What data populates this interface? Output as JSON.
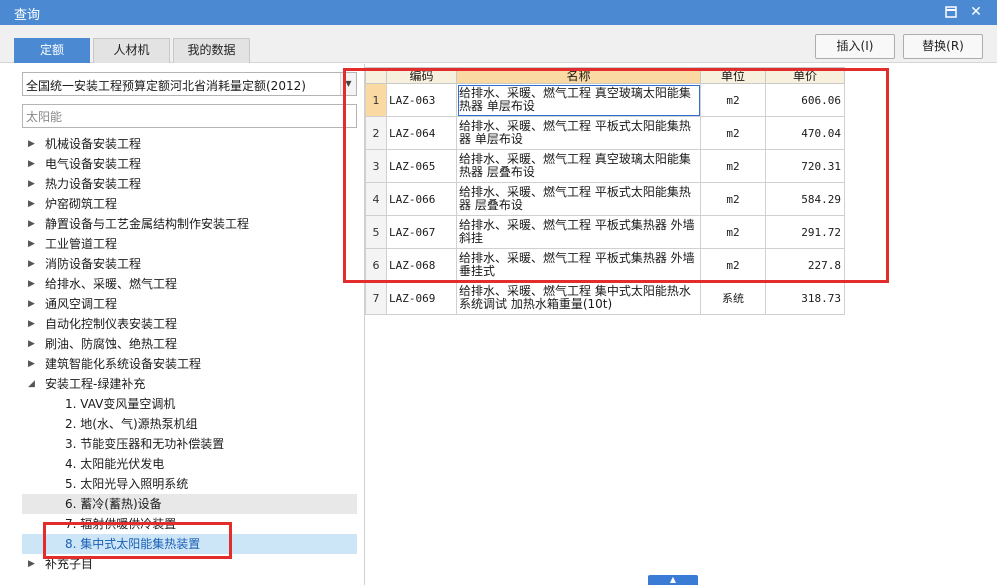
{
  "window": {
    "title": "查询"
  },
  "tabs": [
    {
      "label": "定额",
      "active": true
    },
    {
      "label": "人材机",
      "active": false
    },
    {
      "label": "我的数据",
      "active": false
    }
  ],
  "toolbar": {
    "insert_label": "插入(I)",
    "replace_label": "替换(R)"
  },
  "library": {
    "selected": "全国统一安装工程预算定额河北省消耗量定额(2012)"
  },
  "search": {
    "value": "太阳能"
  },
  "tree": {
    "top_items": [
      "机械设备安装工程",
      "电气设备安装工程",
      "热力设备安装工程",
      "炉窑砌筑工程",
      "静置设备与工艺金属结构制作安装工程",
      "工业管道工程",
      "消防设备安装工程",
      "给排水、采暖、燃气工程",
      "通风空调工程",
      "自动化控制仪表安装工程",
      "刷油、防腐蚀、绝热工程",
      "建筑智能化系统设备安装工程"
    ],
    "expanded": {
      "label": "安装工程-绿建补充",
      "children": [
        "1. VAV变风量空调机",
        "2. 地(水、气)源热泵机组",
        "3. 节能变压器和无功补偿装置",
        "4. 太阳能光伏发电",
        "5. 太阳光导入照明系统",
        "6. 蓄冷(蓄热)设备",
        "7. 辐射供暖供冷装置",
        "8. 集中式太阳能集热装置"
      ]
    },
    "last_item": "补充子目"
  },
  "grid": {
    "headers": {
      "code": "编码",
      "name": "名称",
      "unit": "单位",
      "price": "单价"
    },
    "rows": [
      {
        "no": "1",
        "code": "LAZ-063",
        "name": "给排水、采暖、燃气工程 真空玻璃太阳能集热器 单层布设",
        "unit": "m2",
        "price": "606.06"
      },
      {
        "no": "2",
        "code": "LAZ-064",
        "name": "给排水、采暖、燃气工程 平板式太阳能集热器 单层布设",
        "unit": "m2",
        "price": "470.04"
      },
      {
        "no": "3",
        "code": "LAZ-065",
        "name": "给排水、采暖、燃气工程 真空玻璃太阳能集热器 层叠布设",
        "unit": "m2",
        "price": "720.31"
      },
      {
        "no": "4",
        "code": "LAZ-066",
        "name": "给排水、采暖、燃气工程 平板式太阳能集热器 层叠布设",
        "unit": "m2",
        "price": "584.29"
      },
      {
        "no": "5",
        "code": "LAZ-067",
        "name": "给排水、采暖、燃气工程 平板式集热器 外墙斜挂",
        "unit": "m2",
        "price": "291.72"
      },
      {
        "no": "6",
        "code": "LAZ-068",
        "name": "给排水、采暖、燃气工程 平板式集热器 外墙垂挂式",
        "unit": "m2",
        "price": "227.8"
      },
      {
        "no": "7",
        "code": "LAZ-069",
        "name": "给排水、采暖、燃气工程 集中式太阳能热水系统调试 加热水箱重量(10t)",
        "unit": "系统",
        "price": "318.73"
      }
    ]
  },
  "colors": {
    "accent": "#4b8ad3",
    "highlight_red": "#e32c2c",
    "header_sorted": "#fbd9a2"
  }
}
